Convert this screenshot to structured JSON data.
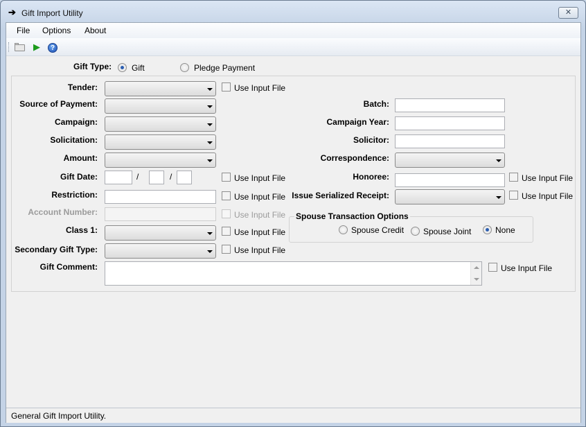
{
  "window": {
    "title": "Gift Import Utility",
    "close_glyph": "✕",
    "title_icon": "arrow-right-icon"
  },
  "menu": {
    "items": [
      "File",
      "Options",
      "About"
    ]
  },
  "toolbar": {
    "icons": [
      "open-folder-icon",
      "run-icon",
      "help-icon"
    ],
    "help_glyph": "?"
  },
  "gift_type": {
    "label": "Gift Type:",
    "options": [
      {
        "label": "Gift",
        "checked": true
      },
      {
        "label": "Pledge Payment",
        "checked": false
      }
    ]
  },
  "left_fields": {
    "tender": "Tender:",
    "source_of_payment": "Source of Payment:",
    "campaign": "Campaign:",
    "solicitation": "Solicitation:",
    "amount": "Amount:",
    "gift_date": "Gift Date:",
    "restriction": "Restriction:",
    "account_number": "Account Number:",
    "class_1": "Class 1:",
    "secondary_gift_type": "Secondary Gift Type:",
    "gift_comment": "Gift Comment:"
  },
  "date_separator": "/",
  "right_fields": {
    "batch": "Batch:",
    "campaign_year": "Campaign Year:",
    "solicitor": "Solicitor:",
    "correspondence": "Correspondence:",
    "honoree": "Honoree:",
    "issue_serialized_receipt": "Issue Serialized Receipt:"
  },
  "use_input_file": "Use Input File",
  "spouse_options": {
    "title": "Spouse Transaction Options",
    "options": [
      {
        "label": "Spouse Credit",
        "checked": false
      },
      {
        "label": "Spouse Joint",
        "checked": false
      },
      {
        "label": "None",
        "checked": true
      }
    ]
  },
  "status": {
    "text": "General Gift Import Utility."
  }
}
